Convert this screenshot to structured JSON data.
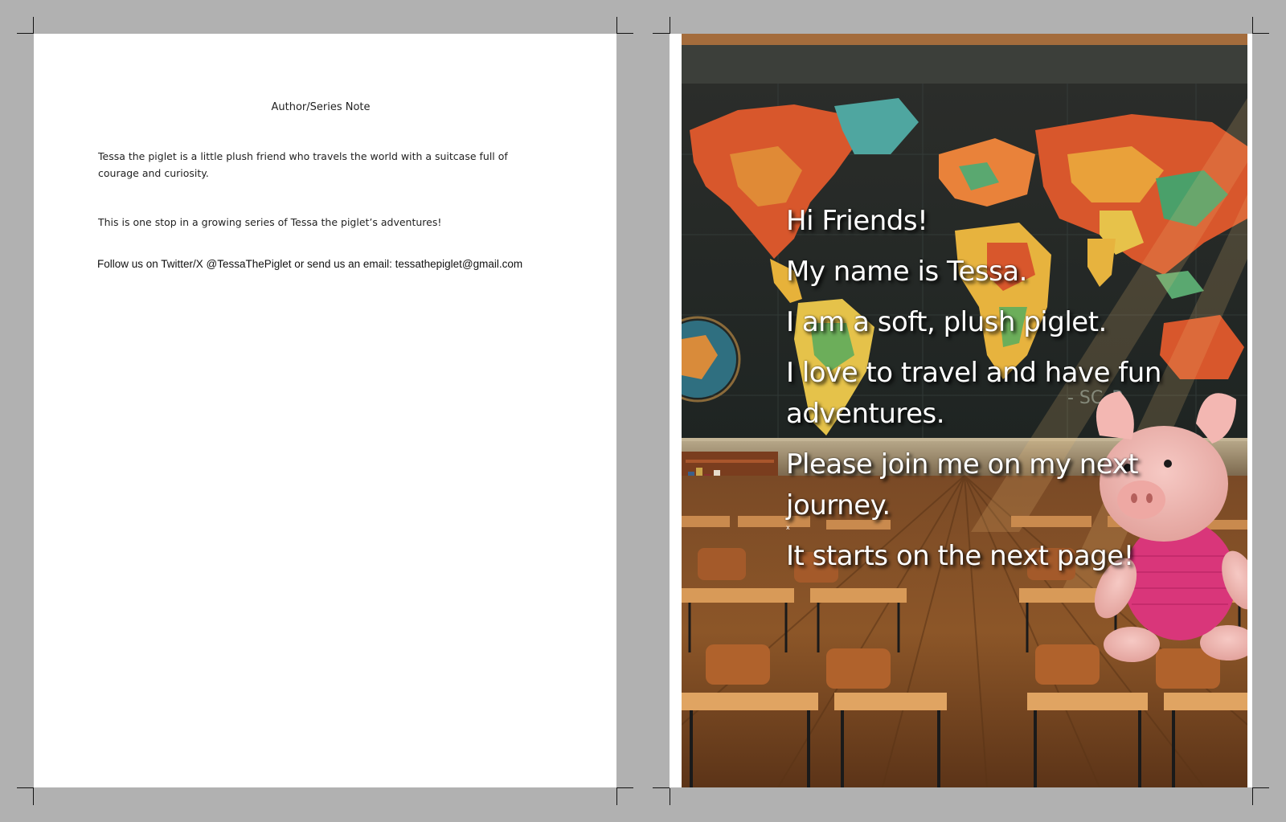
{
  "left_page": {
    "heading": "Author/Series Note",
    "paragraph_1": "Tessa the piglet is a little plush friend who travels the world with a suitcase full of courage and curiosity.",
    "paragraph_2": "This is one stop in a growing series of Tessa the piglet’s adventures!",
    "follow_line": "Follow us on Twitter/X @TessaThePiglet or send us an email: tessathepiglet@gmail.com"
  },
  "right_page": {
    "illustration": "classroom-world-map-with-plush-piglet",
    "lines": [
      "Hi Friends!",
      "My name is Tessa.",
      "I am a soft, plush piglet.",
      "I love to travel and have fun adventures.",
      "Please join me on my next journey.",
      "It starts on the next page!"
    ],
    "small_mark": "x"
  },
  "colors": {
    "pasteboard": "#b1b1b1",
    "page": "#ffffff",
    "text": "#222222",
    "story_text": "#ffffff"
  }
}
